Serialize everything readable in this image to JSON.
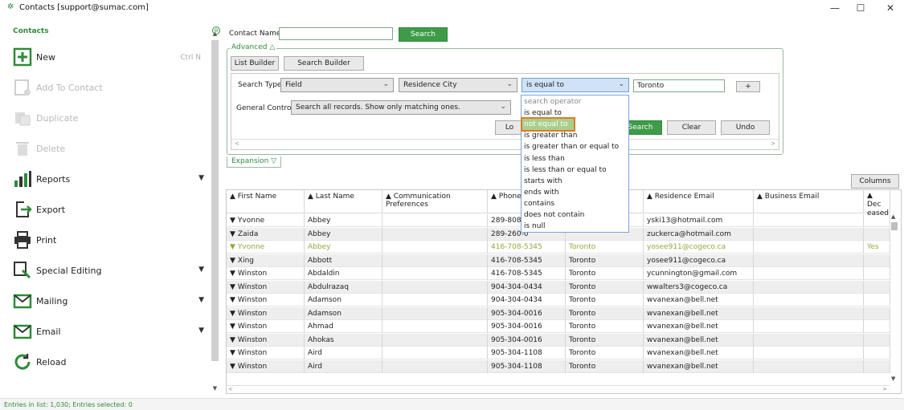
{
  "window": {
    "title": "Contacts    [support@sumac.com]",
    "controls": [
      "—",
      "☐",
      "✕"
    ]
  },
  "sidebar": {
    "header": "Contacts",
    "items": [
      {
        "label": "New",
        "shortcut": "Ctrl N",
        "icon": "plus-square-icon",
        "enabled": true,
        "chevron": false
      },
      {
        "label": "Add To Contact",
        "icon": "add-contact-icon",
        "enabled": false,
        "chevron": false
      },
      {
        "label": "Duplicate",
        "icon": "duplicate-icon",
        "enabled": false,
        "chevron": false
      },
      {
        "label": "Delete",
        "icon": "trash-icon",
        "enabled": false,
        "chevron": false
      },
      {
        "label": "Reports",
        "icon": "bar-chart-icon",
        "enabled": true,
        "chevron": true
      },
      {
        "label": "Export",
        "icon": "export-icon",
        "enabled": true,
        "chevron": false
      },
      {
        "label": "Print",
        "icon": "printer-icon",
        "enabled": true,
        "chevron": false
      },
      {
        "label": "Special Editing",
        "icon": "special-edit-icon",
        "enabled": true,
        "chevron": true
      },
      {
        "label": "Mailing",
        "icon": "mail-icon",
        "enabled": true,
        "chevron": true
      },
      {
        "label": "Email",
        "icon": "email-icon",
        "enabled": true,
        "chevron": true
      },
      {
        "label": "Reload",
        "icon": "reload-icon",
        "enabled": true,
        "chevron": false
      }
    ]
  },
  "search": {
    "contact_name_label": "Contact Name",
    "contact_name_value": "",
    "search_button": "Search",
    "advanced_label": "Advanced △",
    "list_builder": "List Builder",
    "search_builder": "Search Builder",
    "search_type_label": "Search Type:",
    "search_type_value": "Field",
    "field_value": "Residence City",
    "operator_value": "is equal to",
    "criteria_value": "Toronto",
    "add_button": "+",
    "general_control_label": "General Control:",
    "general_control_value": "Search all records. Show only matching ones.",
    "load_button": "Lo",
    "run_search_button": "Search",
    "clear_button": "Clear",
    "undo_button": "Undo",
    "expansion_label": "Expansion ▽",
    "columns_button": "Columns"
  },
  "operator_dropdown": {
    "options": [
      "search operator",
      "is equal to",
      "not equal to",
      "is greater than",
      "is greater than or equal to",
      "is less than",
      "is less than or equal to",
      "starts with",
      "ends with",
      "contains",
      "does not contain",
      "is null"
    ],
    "highlighted_index": 2
  },
  "grid": {
    "columns": [
      "First Name",
      "Last Name",
      "Communication Preferences",
      "Phone",
      "",
      "Residence Email",
      "Business Email",
      "Dec\neased"
    ],
    "rows": [
      [
        "Yvonne",
        "Abbey",
        "",
        "289-808-1",
        "",
        "yski13@hotmail.com",
        "",
        ""
      ],
      [
        "Zaida",
        "Abbey",
        "",
        "289-260-0",
        "",
        "zuckerca@hotmail.com",
        "",
        ""
      ],
      [
        "Yvonne",
        "Abbey",
        "",
        "416-708-5345",
        "Toronto",
        "yosee911@cogeco.ca",
        "",
        "Yes"
      ],
      [
        "Xing",
        "Abbott",
        "",
        "416-708-5345",
        "Toronto",
        "yosee911@cogeco.ca",
        "",
        ""
      ],
      [
        "Winston",
        "Abdaldin",
        "",
        "416-708-5345",
        "Toronto",
        "ycunnington@gmail.com",
        "",
        ""
      ],
      [
        "Winston",
        "Abdulrazaq",
        "",
        "904-304-0434",
        "Toronto",
        "wwalters3@cogeco.ca",
        "",
        ""
      ],
      [
        "Winston",
        "Adamson",
        "",
        "904-304-0434",
        "Toronto",
        "wvanexan@bell.net",
        "",
        ""
      ],
      [
        "Winston",
        "Adamson",
        "",
        "905-304-0016",
        "Toronto",
        "wvanexan@bell.net",
        "",
        ""
      ],
      [
        "Winston",
        "Ahmad",
        "",
        "905-304-0016",
        "Toronto",
        "wvanexan@bell.net",
        "",
        ""
      ],
      [
        "Winston",
        "Ahokas",
        "",
        "905-304-0016",
        "Toronto",
        "wvanexan@bell.net",
        "",
        ""
      ],
      [
        "Winston",
        "Aird",
        "",
        "905-304-1108",
        "Toronto",
        "wvanexan@bell.net",
        "",
        ""
      ],
      [
        "Winston",
        "Aird",
        "",
        "905-304-1108",
        "Toronto",
        "wvanexan@bell.net",
        "",
        ""
      ]
    ],
    "dim_row_index": 2,
    "sort_glyph": "▲",
    "row_glyph": "▼"
  },
  "status": {
    "text": "Entries in list: 1,030; Entries selected: 0"
  },
  "colors": {
    "accent": "#2e8b3a",
    "button_green": "#3e9b48",
    "dropdown_highlight": "#a9cf8f",
    "highlight_outline": "#e07b21",
    "active_select": "#cfe2f6"
  }
}
